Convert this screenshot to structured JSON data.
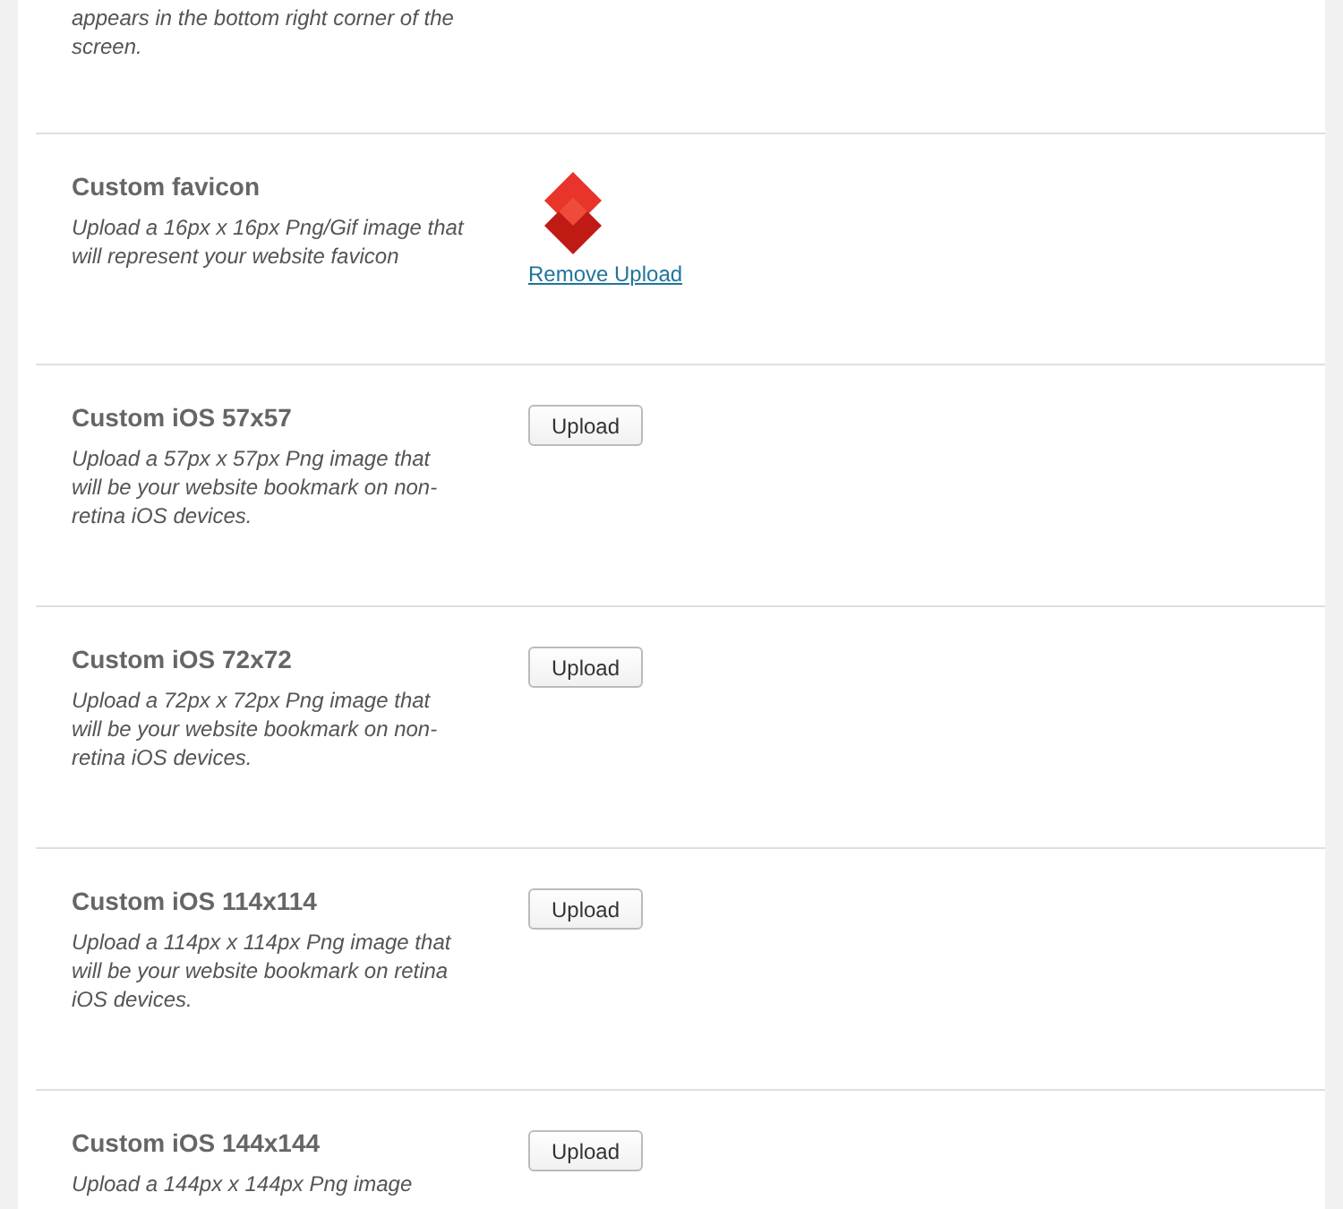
{
  "intro_text": "appears in the bottom right corner of the screen.",
  "settings": [
    {
      "kind": "image",
      "title": "Custom favicon",
      "description": "Upload a 16px x 16px Png/Gif image that will represent your website favicon",
      "link": "Remove Upload"
    },
    {
      "kind": "upload",
      "title": "Custom iOS 57x57",
      "description": "Upload a 57px x 57px Png image that will be your website bookmark on non-retina iOS devices.",
      "button": "Upload"
    },
    {
      "kind": "upload",
      "title": "Custom iOS 72x72",
      "description": "Upload a 72px x 72px Png image that will be your website bookmark on non-retina iOS devices.",
      "button": "Upload"
    },
    {
      "kind": "upload",
      "title": "Custom iOS 114x114",
      "description": "Upload a 114px x 114px Png image that will be your website bookmark on retina iOS devices.",
      "button": "Upload"
    },
    {
      "kind": "upload",
      "title": "Custom iOS 144x144",
      "description": "Upload a 144px x 144px Png image",
      "button": "Upload"
    }
  ]
}
